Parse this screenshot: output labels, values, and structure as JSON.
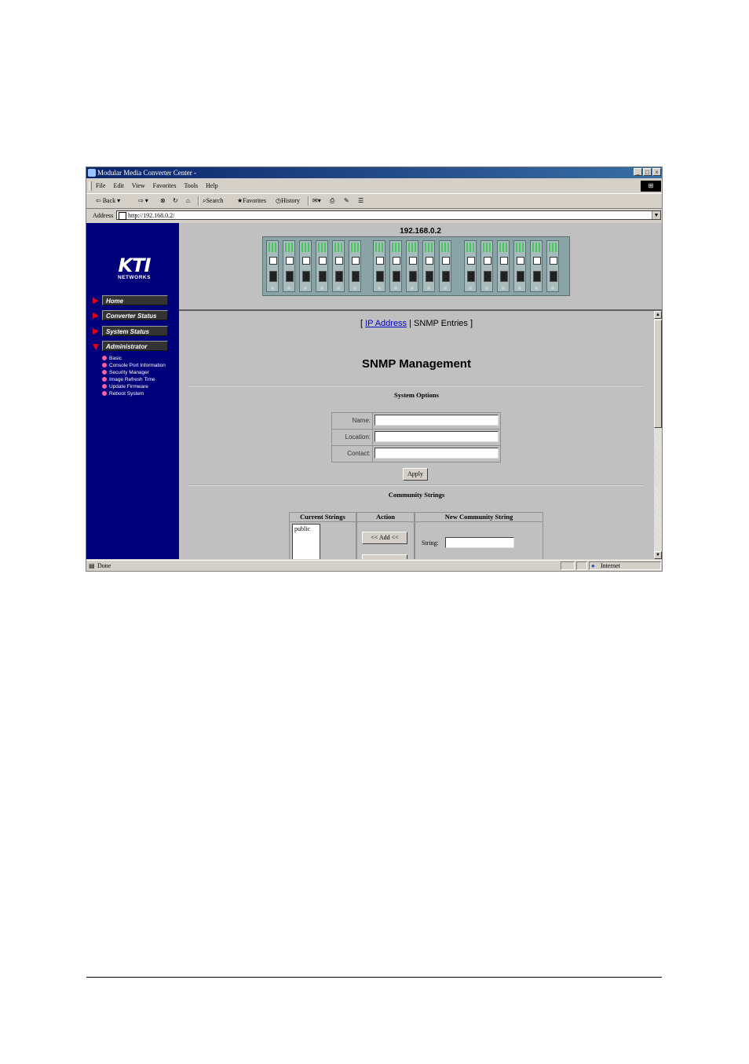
{
  "window": {
    "title": "Modular Media Converter Center -",
    "controls": [
      "_",
      "□",
      "×"
    ]
  },
  "menu": [
    "File",
    "Edit",
    "View",
    "Favorites",
    "Tools",
    "Help"
  ],
  "toolbar": {
    "back": "Back",
    "search": "Search",
    "favorites": "Favorites",
    "history": "History"
  },
  "address": {
    "label": "Address",
    "url": "http://192.168.0.2/"
  },
  "sidebar": {
    "logo": "KTI",
    "logo_sub": "NETWORKS",
    "nav": [
      "Home",
      "Converter Status",
      "System Status",
      "Administrator"
    ],
    "sub": [
      "Basic",
      "Console Port Information",
      "Security Manager",
      "Image Refresh Time",
      "Update Firmware",
      "Reboot System"
    ]
  },
  "banner": {
    "ip": "192.168.0.2"
  },
  "main": {
    "crumb_open": "[",
    "crumb_link": "IP Address",
    "crumb_sep": "|",
    "crumb_current": "SNMP Entries",
    "crumb_close": "]",
    "title": "SNMP Management",
    "system_options": "System Options",
    "fields": [
      "Name:",
      "Location:",
      "Contact:"
    ],
    "apply": "Apply",
    "community": "Community Strings",
    "col_current": "Current Strings",
    "col_action": "Action",
    "col_new": "New Community String",
    "current_list": [
      "public"
    ],
    "add_btn": "<< Add <<",
    "string_label": "String:"
  },
  "status": {
    "text": "Done",
    "zone": "Internet"
  }
}
